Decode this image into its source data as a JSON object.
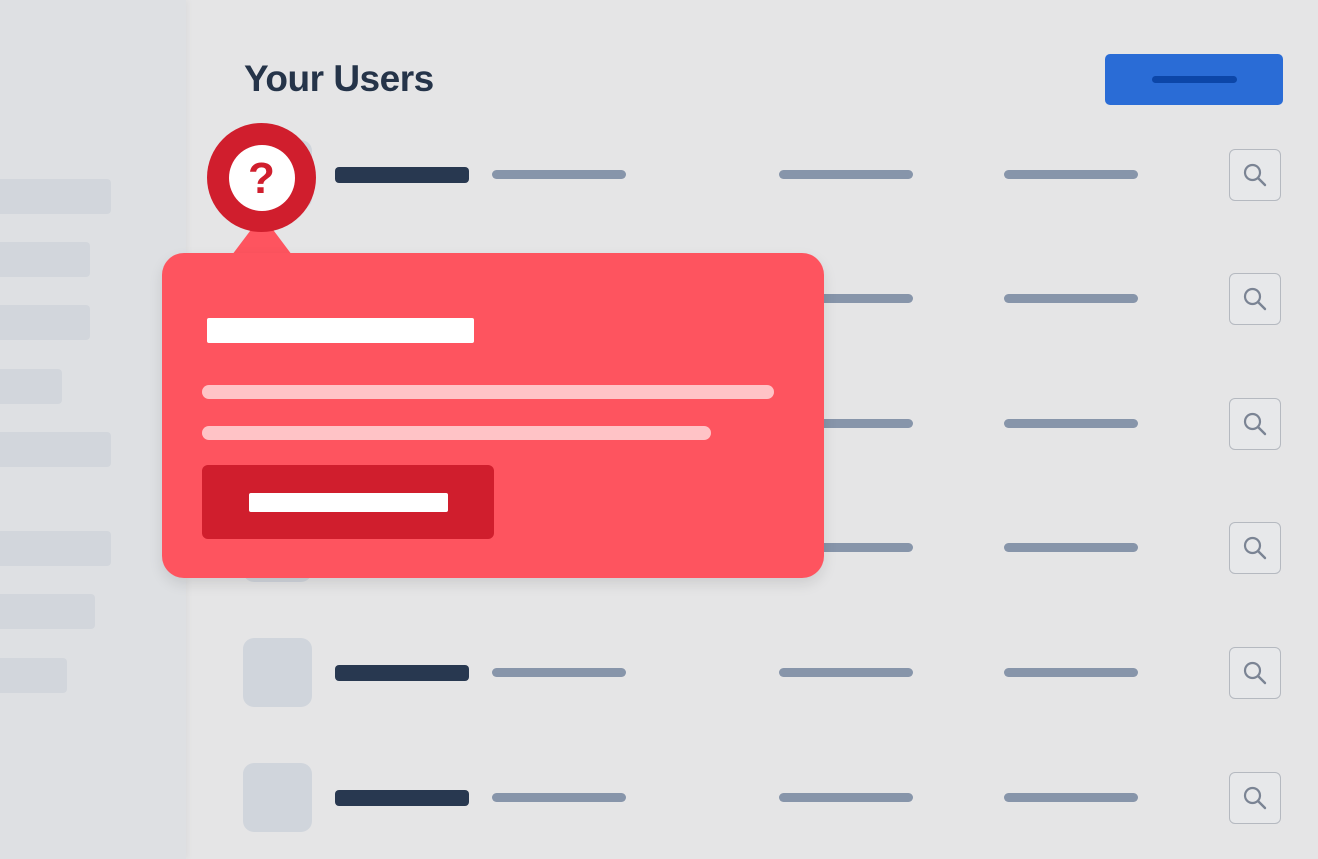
{
  "page": {
    "title": "Your Users"
  },
  "header": {
    "primary_button_icon": "placeholder-label-bar"
  },
  "sidebar": {
    "items": [
      "nav-item",
      "nav-item",
      "nav-item",
      "nav-item",
      "nav-item",
      "nav-item",
      "nav-item",
      "nav-item"
    ]
  },
  "table": {
    "rows": [
      {
        "avatar": "avatar-placeholder",
        "action_icon": "search-icon"
      },
      {
        "avatar": "avatar-placeholder",
        "action_icon": "search-icon"
      },
      {
        "avatar": "avatar-placeholder",
        "action_icon": "search-icon"
      },
      {
        "avatar": "avatar-placeholder",
        "action_icon": "search-icon"
      },
      {
        "avatar": "avatar-placeholder",
        "action_icon": "search-icon"
      },
      {
        "avatar": "avatar-placeholder",
        "action_icon": "search-icon"
      }
    ]
  },
  "help": {
    "icon": "question-mark-icon",
    "glyph": "?"
  },
  "popover": {
    "icon_state": "open"
  },
  "colors": {
    "background": "#e5e5e6",
    "sidebar": "#dee0e3",
    "title_text": "#253449",
    "primary_button": "#2a6cd6",
    "primary_button_dash": "#0c46a8",
    "name_bar": "#283850",
    "cell_bar": "#8795aa",
    "popover": "#fe545f",
    "popover_lines": "#ffc3c6",
    "alert_red": "#d01e2d"
  }
}
